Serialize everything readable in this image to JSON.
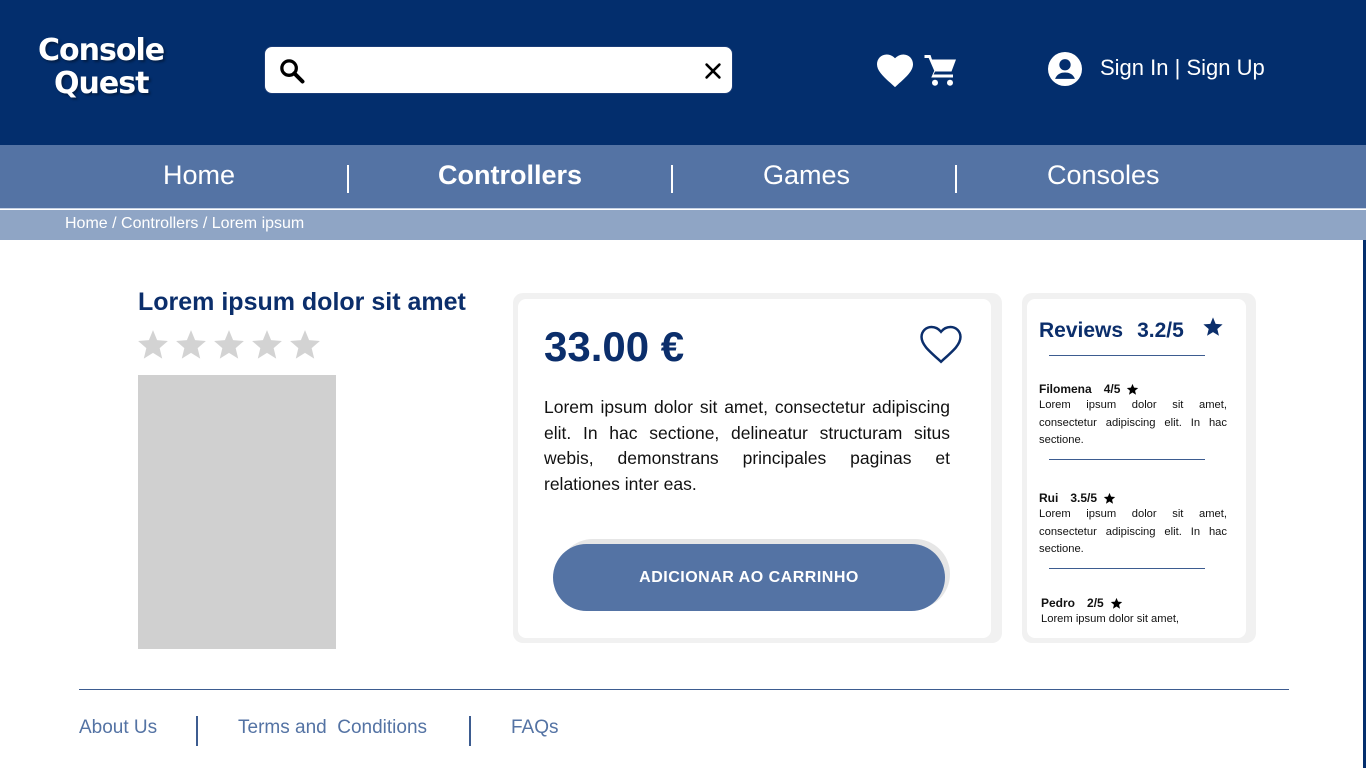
{
  "brand": {
    "line1": "Console",
    "line2": "Quest"
  },
  "search": {
    "value": "",
    "placeholder": ""
  },
  "header": {
    "sign_in": "Sign In",
    "separator": "|",
    "sign_up": "Sign Up"
  },
  "nav": {
    "items": [
      {
        "label": "Home",
        "active": false
      },
      {
        "label": "Controllers",
        "active": true
      },
      {
        "label": "Games",
        "active": false
      },
      {
        "label": "Consoles",
        "active": false
      }
    ]
  },
  "breadcrumb": {
    "items": [
      "Home",
      "Controllers",
      "Lorem ipsum"
    ],
    "separator": "/"
  },
  "product": {
    "title": "Lorem ipsum dolor sit amet",
    "rating_stars": 0,
    "max_stars": 5,
    "price": "33.00 €",
    "description": "Lorem ipsum dolor sit amet, consectetur adipiscing elit. In hac sectione, delineatur structuram situs webis, demonstrans principales paginas et relationes inter eas.",
    "add_to_cart_label": "ADICIONAR AO CARRINHO"
  },
  "reviews": {
    "title": "Reviews",
    "score": "3.2/5",
    "items": [
      {
        "author": "Filomena",
        "score": "4/5",
        "text": "Lorem ipsum dolor sit amet, consectetur adipiscing elit. In hac sectione."
      },
      {
        "author": "Rui",
        "score": "3.5/5",
        "text": "Lorem ipsum dolor sit amet, consectetur adipiscing elit. In hac sectione."
      },
      {
        "author": "Pedro",
        "score": "2/5",
        "text": "Lorem ipsum dolor sit amet,"
      }
    ]
  },
  "footer": {
    "links": [
      "About Us",
      "Terms and  Conditions",
      "FAQs"
    ]
  },
  "colors": {
    "header_bg": "#032e6d",
    "nav_bg": "#5473a4",
    "breadcrumb_bg": "#8fa5c5",
    "accent": "#0b2e6b",
    "button_bg": "#5473a4",
    "star_empty": "#d3d3d3"
  },
  "icons": [
    "search-icon",
    "clear-icon",
    "heart-icon",
    "cart-icon",
    "user-icon",
    "star-icon",
    "heart-outline-icon"
  ]
}
